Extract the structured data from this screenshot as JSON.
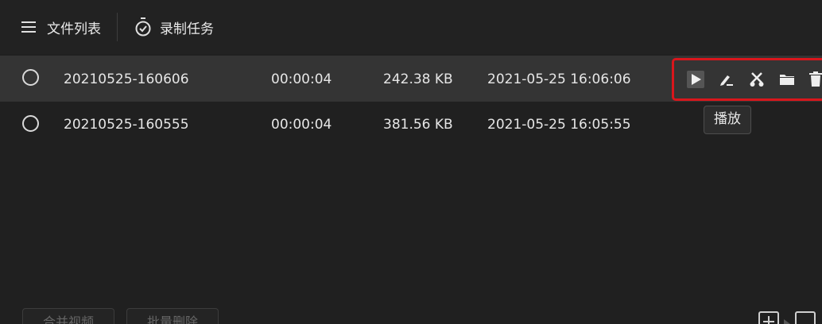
{
  "header": {
    "tab_files_label": "文件列表",
    "tab_tasks_label": "录制任务"
  },
  "files": [
    {
      "name": "20210525-160606",
      "duration": "00:00:04",
      "size": "242.38 KB",
      "date": "2021-05-25 16:06:06",
      "selected": true
    },
    {
      "name": "20210525-160555",
      "duration": "00:00:04",
      "size": "381.56 KB",
      "date": "2021-05-25 16:05:55",
      "selected": false
    }
  ],
  "actions": {
    "icons": [
      "play-icon",
      "edit-icon",
      "cut-icon",
      "folder-icon",
      "delete-icon"
    ],
    "highlight_color": "#d9161c"
  },
  "tooltip": {
    "text": "播放"
  },
  "footer": {
    "merge_label": "合并视频",
    "batch_delete_label": "批量删除"
  },
  "colors": {
    "background": "#202020",
    "selected_row": "#343434",
    "text": "#e6e6e6"
  }
}
